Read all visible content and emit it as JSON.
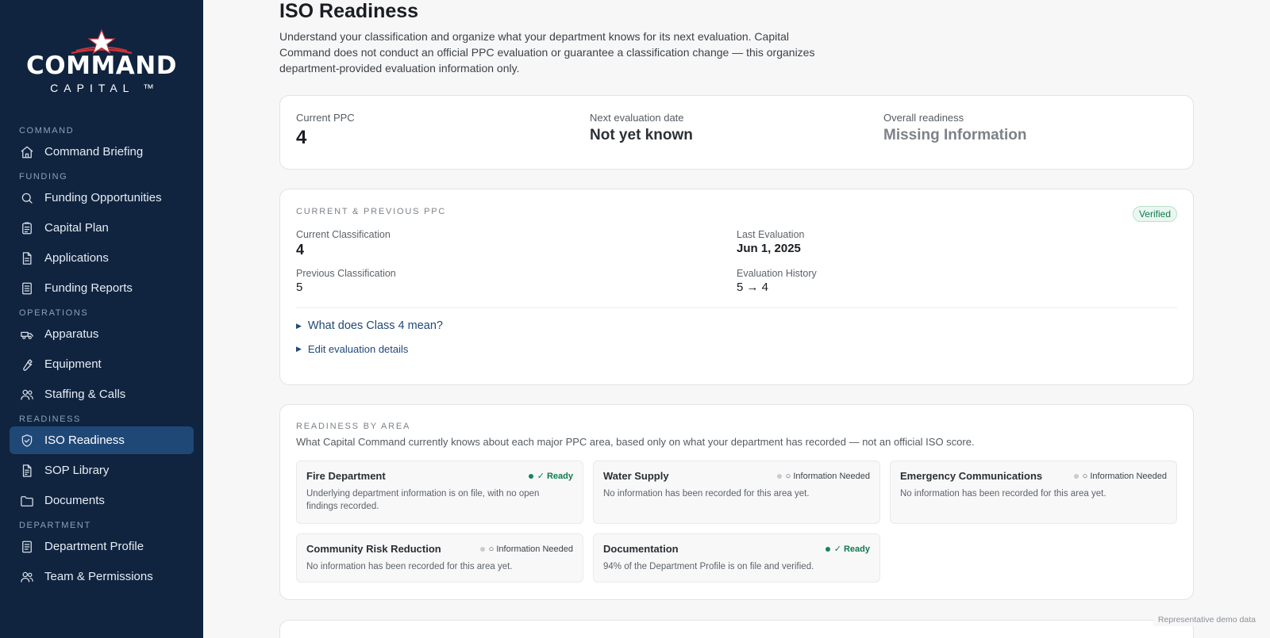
{
  "app": {
    "logo_word": "COMMAND",
    "logo_sub": "CAPITAL ™"
  },
  "sidebar": {
    "sections": [
      {
        "label": "COMMAND",
        "items": [
          {
            "label": "Command Briefing",
            "icon": "home-icon"
          }
        ]
      },
      {
        "label": "FUNDING",
        "items": [
          {
            "label": "Funding Opportunities",
            "icon": "search-icon"
          },
          {
            "label": "Capital Plan",
            "icon": "clipboard-icon"
          },
          {
            "label": "Applications",
            "icon": "file-icon"
          },
          {
            "label": "Funding Reports",
            "icon": "report-icon"
          }
        ]
      },
      {
        "label": "OPERATIONS",
        "items": [
          {
            "label": "Apparatus",
            "icon": "truck-icon"
          },
          {
            "label": "Equipment",
            "icon": "wrench-icon"
          },
          {
            "label": "Staffing & Calls",
            "icon": "users-icon"
          }
        ]
      },
      {
        "label": "READINESS",
        "items": [
          {
            "label": "ISO Readiness",
            "icon": "shield-check-icon",
            "active": true
          },
          {
            "label": "SOP Library",
            "icon": "book-icon"
          },
          {
            "label": "Documents",
            "icon": "folder-icon"
          }
        ]
      },
      {
        "label": "DEPARTMENT",
        "items": [
          {
            "label": "Department Profile",
            "icon": "profile-icon"
          },
          {
            "label": "Team & Permissions",
            "icon": "team-icon"
          }
        ]
      }
    ]
  },
  "page": {
    "title": "ISO Readiness",
    "intro": "Understand your classification and organize what your department knows for its next evaluation. Capital Command does not conduct an official PPC evaluation or guarantee a classification change — this organizes department-provided evaluation information only."
  },
  "summary": {
    "current_ppc_label": "Current PPC",
    "current_ppc_value": "4",
    "next_eval_label": "Next evaluation date",
    "next_eval_value": "Not yet known",
    "overall_label": "Overall readiness",
    "overall_value": "Missing Information"
  },
  "ppc": {
    "heading": "CURRENT & PREVIOUS PPC",
    "badge": "Verified",
    "current_class_label": "Current Classification",
    "current_class_value": "4",
    "last_eval_label": "Last Evaluation",
    "last_eval_value": "Jun 1, 2025",
    "previous_class_label": "Previous Classification",
    "previous_class_value": "5",
    "history_label": "Evaluation History",
    "history_value": "5 → 4",
    "disclosure_meaning": "What does Class 4 mean?",
    "disclosure_edit": "Edit evaluation details"
  },
  "areas": {
    "heading": "READINESS BY AREA",
    "description": "What Capital Command currently knows about each major PPC area, based only on what your department has recorded — not an official ISO score.",
    "tiles": [
      {
        "name": "Fire Department",
        "status": "✓ Ready",
        "ready": true,
        "text": "Underlying department information is on file, with no open findings recorded."
      },
      {
        "name": "Water Supply",
        "status": "○ Information Needed",
        "ready": false,
        "text": "No information has been recorded for this area yet."
      },
      {
        "name": "Emergency Communications",
        "status": "○ Information Needed",
        "ready": false,
        "text": "No information has been recorded for this area yet."
      },
      {
        "name": "Community Risk Reduction",
        "status": "○ Information Needed",
        "ready": false,
        "text": "No information has been recorded for this area yet."
      },
      {
        "name": "Documentation",
        "status": "✓ Ready",
        "ready": true,
        "text": "94% of the Department Profile is on file and verified."
      }
    ]
  },
  "footer": {
    "demo_note": "Representative demo data"
  }
}
